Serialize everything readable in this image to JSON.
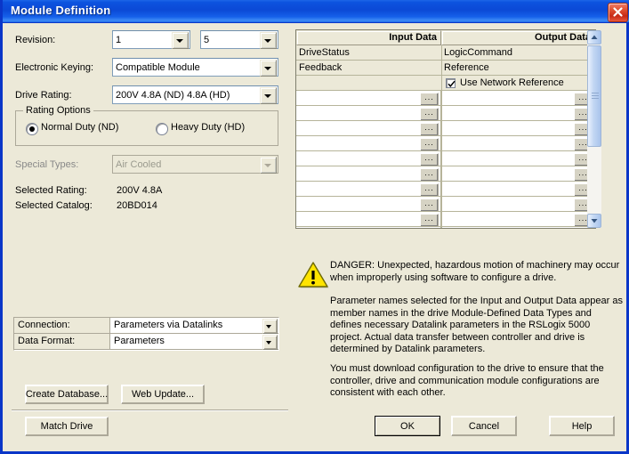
{
  "window": {
    "title": "Module Definition",
    "close_label": "Close"
  },
  "form": {
    "revision_label": "Revision:",
    "revision_major": "1",
    "revision_minor": "5",
    "electronic_keying_label": "Electronic Keying:",
    "electronic_keying_value": "Compatible Module",
    "drive_rating_label": "Drive Rating:",
    "drive_rating_value": "200V  4.8A (ND)  4.8A (HD)",
    "rating_options_title": "Rating Options",
    "normal_duty_label": "Normal Duty (ND)",
    "heavy_duty_label": "Heavy Duty (HD)",
    "normal_duty_selected": true,
    "heavy_duty_selected": false,
    "special_types_label": "Special Types:",
    "special_types_value": "Air Cooled",
    "special_types_disabled": true,
    "selected_rating_label": "Selected Rating:",
    "selected_rating_value": "200V    4.8A",
    "selected_catalog_label": "Selected Catalog:",
    "selected_catalog_value": "20BD014"
  },
  "connection": {
    "connection_label": "Connection:",
    "connection_value": "Parameters via Datalinks",
    "data_format_label": "Data Format:",
    "data_format_value": "Parameters"
  },
  "datagrid": {
    "headers": [
      "Input Data",
      "Output Data"
    ],
    "rows": [
      {
        "input": "DriveStatus",
        "output": "LogicCommand",
        "named": true
      },
      {
        "input": "Feedback",
        "output": "Reference",
        "named": true
      },
      {
        "input": "",
        "output": "Use Network Reference",
        "named": true,
        "checkbox": true,
        "checked": true
      },
      {
        "input": "",
        "output": "",
        "named": false
      },
      {
        "input": "",
        "output": "",
        "named": false
      },
      {
        "input": "",
        "output": "",
        "named": false
      },
      {
        "input": "",
        "output": "",
        "named": false
      },
      {
        "input": "",
        "output": "",
        "named": false
      },
      {
        "input": "",
        "output": "",
        "named": false
      },
      {
        "input": "",
        "output": "",
        "named": false
      },
      {
        "input": "",
        "output": "",
        "named": false
      },
      {
        "input": "",
        "output": "",
        "named": false
      },
      {
        "input": "",
        "output": "",
        "named": false
      },
      {
        "input": "",
        "output": "",
        "named": false
      }
    ],
    "ellipsis_label": "..."
  },
  "warning": {
    "paragraph1": "DANGER: Unexpected, hazardous motion of machinery may occur when improperly using software to configure a drive.",
    "paragraph2": "Parameter names selected for the Input and Output Data appear as member names in the drive Module-Defined Data Types and defines necessary Datalink parameters in the RSLogix 5000 project. Actual data transfer between controller and drive is determined by Datalink parameters.",
    "paragraph3": "You must download configuration to the drive to ensure that the controller, drive and communication module configurations are consistent with each other."
  },
  "buttons": {
    "create_database": "Create Database...",
    "web_update": "Web Update...",
    "match_drive": "Match Drive",
    "ok": "OK",
    "cancel": "Cancel",
    "help": "Help"
  },
  "colors": {
    "dialog_bg": "#ECE9D8",
    "title_blue": "#0B49D6",
    "warning_yellow": "#FFE400",
    "close_red": "#C62A16"
  }
}
